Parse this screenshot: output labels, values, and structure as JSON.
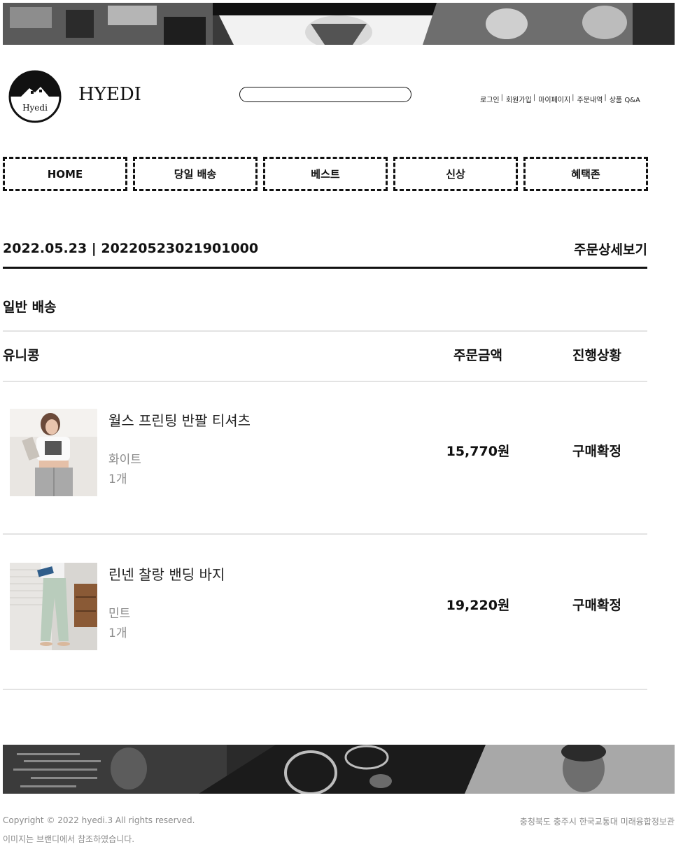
{
  "brand": {
    "name": "HYEDI",
    "logo_text": "Hyedi"
  },
  "search": {
    "value": "",
    "placeholder": ""
  },
  "util_links": [
    "로그인",
    "회원가입",
    "마이페이지",
    "주문내역",
    "상품 Q&A"
  ],
  "util_separator": "|",
  "nav": [
    "HOME",
    "당일 배송",
    "베스트",
    "신상",
    "혜택존"
  ],
  "order": {
    "header": "2022.05.23 | 20220523021901000",
    "detail_link": "주문상세보기",
    "section": "일반 배송",
    "columns": {
      "store": "유니콩",
      "amount": "주문금액",
      "status": "진행상황"
    },
    "items": [
      {
        "name": "월스 프린팅 반팔 티셔츠",
        "option": "화이트",
        "qty": "1개",
        "price": "15,770원",
        "status": "구매확정"
      },
      {
        "name": "린넨 찰랑 밴딩 바지",
        "option": "민트",
        "qty": "1개",
        "price": "19,220원",
        "status": "구매확정"
      }
    ]
  },
  "footer": {
    "copyright": "Copyright © 2022 hyedi.3 All rights reserved.",
    "note": "이미지는 브랜디에서 참조하였습니다.",
    "address": "충청북도 충주시 한국교통대 미래융합정보관"
  },
  "colors": {
    "text": "#111111",
    "muted": "#8c8c8c",
    "divider": "#e3e3e3",
    "accent": "#000000"
  }
}
